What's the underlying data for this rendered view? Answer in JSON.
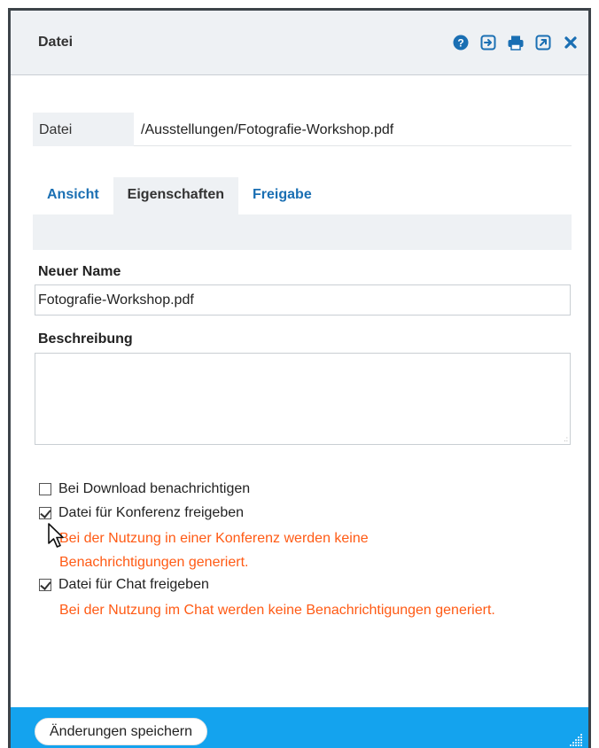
{
  "window": {
    "title": "Datei"
  },
  "toolbar": {
    "icons": [
      "help-icon",
      "exit-icon",
      "print-icon",
      "open-external-icon",
      "close-icon"
    ],
    "accent": "#1a6fb3"
  },
  "file": {
    "label": "Datei",
    "path": "/Ausstellungen/Fotografie-Workshop.pdf"
  },
  "tabs": [
    {
      "label": "Ansicht",
      "active": false
    },
    {
      "label": "Eigenschaften",
      "active": true
    },
    {
      "label": "Freigabe",
      "active": false
    }
  ],
  "form": {
    "name_label": "Neuer Name",
    "name_value": "Fotografie-Workshop.pdf",
    "description_label": "Beschreibung",
    "description_value": ""
  },
  "options": [
    {
      "label": "Bei Download benachrichtigen",
      "checked": false
    },
    {
      "label": "Datei für Konferenz freigeben",
      "checked": true,
      "note": [
        "Bei der Nutzung in einer Konferenz werden keine",
        "Benachrichtigungen generiert."
      ]
    },
    {
      "label": "Datei für Chat freigeben",
      "checked": true,
      "note": [
        "Bei der Nutzung im Chat werden keine Benachrichtigungen generiert."
      ]
    }
  ],
  "colors": {
    "warning": "#ff5a14",
    "footer": "#14a3ee"
  },
  "footer": {
    "save_label": "Änderungen speichern"
  }
}
